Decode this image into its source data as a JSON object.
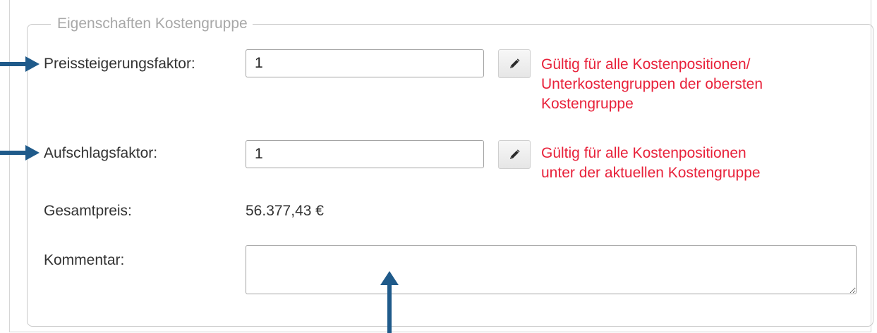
{
  "legend": "Eigenschaften Kostengruppe",
  "fields": {
    "preissteigerung": {
      "label": "Preissteigerungsfaktor:",
      "value": "1",
      "hint_lines": [
        "Gültig für alle Kostenpositionen/",
        "Unterkostengruppen der obersten",
        "Kostengruppe"
      ]
    },
    "aufschlag": {
      "label": "Aufschlagsfaktor:",
      "value": "1",
      "hint_lines": [
        "Gültig für alle Kostenpositionen",
        "unter der aktuellen Kostengruppe"
      ]
    },
    "gesamtpreis": {
      "label": "Gesamtpreis:",
      "value": "56.377,43 €"
    },
    "kommentar": {
      "label": "Kommentar:",
      "value": ""
    }
  },
  "icons": {
    "edit": "pencil-icon",
    "annotation": "arrow-icon"
  },
  "colors": {
    "hint": "#e8213a",
    "legend": "#a8a8a8",
    "label": "#333333",
    "annotation_arrow": "#1f5a8a",
    "border": "#c9c9c9"
  }
}
